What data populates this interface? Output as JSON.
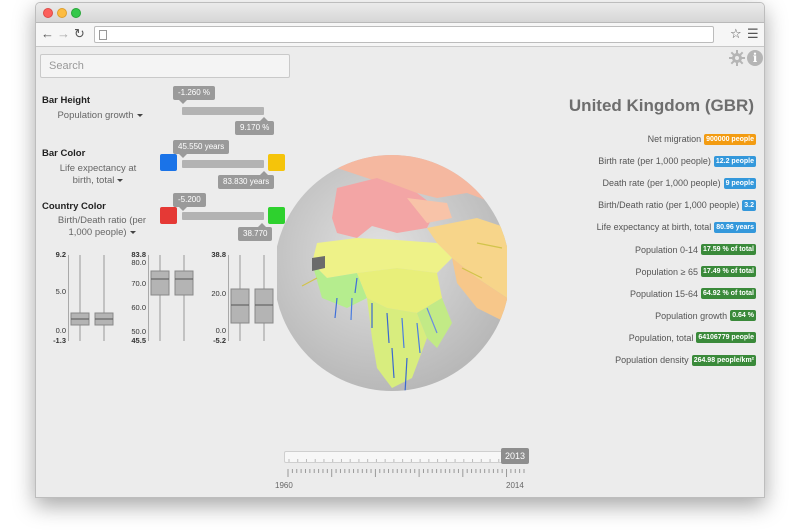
{
  "search": {
    "placeholder": "Search"
  },
  "controls": {
    "bar_height": {
      "label": "Bar Height",
      "indicator": "Population growth",
      "min_value": "-1.260 %",
      "max_value": "9.170 %"
    },
    "bar_color": {
      "label": "Bar Color",
      "indicator_line1": "Life expectancy at",
      "indicator_line2": "birth, total",
      "min_value": "45.550 years",
      "max_value": "83.830 years",
      "min_color": "#1a73e8",
      "max_color": "#f5c40a"
    },
    "country_color": {
      "label": "Country Color",
      "indicator_line1": "Birth/Death ratio (per",
      "indicator_line2": "1,000 people)",
      "min_value": "-5.200",
      "max_value": "38.770",
      "min_color": "#e53935",
      "max_color": "#2ed12e"
    }
  },
  "boxplots": [
    {
      "top": "9.2",
      "mid": "5.0",
      "lowmid": "0.0",
      "bottom": "-1.3"
    },
    {
      "top": "83.8",
      "t2": "80.0",
      "t3": "70.0",
      "t4": "60.0",
      "t5": "50.0",
      "bottom": "45.5"
    },
    {
      "top": "38.8",
      "t2": "20.0",
      "t3": "0.0",
      "bottom": "-5.2"
    }
  ],
  "country": {
    "title": "United Kingdom (GBR)",
    "stats": [
      {
        "label": "Net migration",
        "value": "900000 people",
        "color": "#f39c12"
      },
      {
        "label": "Birth rate (per 1,000 people)",
        "value": "12.2 people",
        "color": "#3498db"
      },
      {
        "label": "Death rate (per 1,000 people)",
        "value": "9 people",
        "color": "#3498db"
      },
      {
        "label": "Birth/Death ratio (per 1,000 people)",
        "value": "3.2",
        "color": "#3498db"
      },
      {
        "label": "Life expectancy at birth, total",
        "value": "80.96 years",
        "color": "#3498db"
      },
      {
        "label": "Population 0-14",
        "value": "17.59 % of total",
        "color": "#3a8a3a"
      },
      {
        "label": "Population ≥ 65",
        "value": "17.49 % of total",
        "color": "#3a8a3a"
      },
      {
        "label": "Population 15-64",
        "value": "64.92 % of total",
        "color": "#3a8a3a"
      },
      {
        "label": "Population growth",
        "value": "0.64 %",
        "color": "#3a8a3a"
      },
      {
        "label": "Population, total",
        "value": "64106779 people",
        "color": "#3a8a3a"
      },
      {
        "label": "Population density",
        "value": "264.98 people/km²",
        "color": "#3a8a3a"
      }
    ]
  },
  "timeline": {
    "selected_year": "2013",
    "start_year": "1960",
    "end_year": "2014"
  },
  "icons": {
    "settings": "gear-icon",
    "info": "info-icon",
    "back": "arrow-left-icon",
    "forward": "arrow-right-icon",
    "reload": "reload-icon",
    "bookmark": "star-icon",
    "menu": "hamburger-menu-icon"
  }
}
